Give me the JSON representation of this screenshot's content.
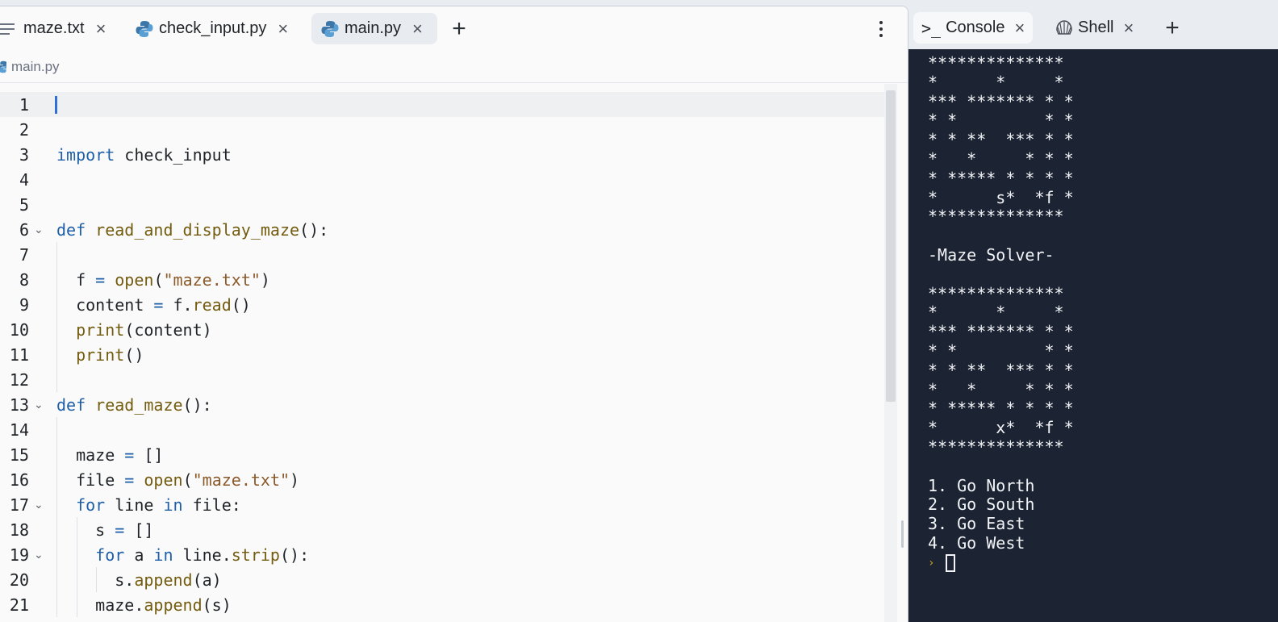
{
  "editor": {
    "tabs": [
      {
        "label": "maze.txt",
        "icon": "text-file-icon",
        "active": false
      },
      {
        "label": "check_input.py",
        "icon": "python-icon",
        "active": false
      },
      {
        "label": "main.py",
        "icon": "python-icon",
        "active": true
      }
    ],
    "tab_close_glyph": "×",
    "add_tab_glyph": "+",
    "breadcrumb": "main.py",
    "lines": [
      {
        "n": "1",
        "html": ""
      },
      {
        "n": "2",
        "html": ""
      },
      {
        "n": "3",
        "html": "<span class='kw'>import</span> check_input"
      },
      {
        "n": "4",
        "html": ""
      },
      {
        "n": "5",
        "html": ""
      },
      {
        "n": "6",
        "html": "<span class='kw'>def</span> <span class='fn'>read_and_display_maze</span>():",
        "fold": true
      },
      {
        "n": "7",
        "html": "",
        "indent": 1
      },
      {
        "n": "8",
        "html": "  f <span class='op'>=</span> <span class='fn'>open</span>(<span class='str'>\"maze.txt\"</span>)",
        "indent": 1
      },
      {
        "n": "9",
        "html": "  content <span class='op'>=</span> f.<span class='fn'>read</span>()",
        "indent": 1
      },
      {
        "n": "10",
        "html": "  <span class='fn'>print</span>(content)",
        "indent": 1
      },
      {
        "n": "11",
        "html": "  <span class='fn'>print</span>()",
        "indent": 1
      },
      {
        "n": "12",
        "html": "",
        "indent": 1
      },
      {
        "n": "13",
        "html": "<span class='kw'>def</span> <span class='fn'>read_maze</span>():",
        "fold": true
      },
      {
        "n": "14",
        "html": "",
        "indent": 1
      },
      {
        "n": "15",
        "html": "  maze <span class='op'>=</span> []",
        "indent": 1
      },
      {
        "n": "16",
        "html": "  file <span class='op'>=</span> <span class='fn'>open</span>(<span class='str'>\"maze.txt\"</span>)",
        "indent": 1
      },
      {
        "n": "17",
        "html": "  <span class='kw'>for</span> line <span class='kw'>in</span> file:",
        "fold": true,
        "indent": 1
      },
      {
        "n": "18",
        "html": "    s <span class='op'>=</span> []",
        "indent": 2
      },
      {
        "n": "19",
        "html": "    <span class='kw'>for</span> a <span class='kw'>in</span> line.<span class='fn'>strip</span>():",
        "fold": true,
        "indent": 2
      },
      {
        "n": "20",
        "html": "      s.<span class='fn'>append</span>(a)",
        "indent": 3
      },
      {
        "n": "21",
        "html": "    maze.<span class='fn'>append</span>(s)",
        "indent": 2
      }
    ]
  },
  "console": {
    "tabs": [
      {
        "label": "Console",
        "glyph": ">_",
        "active": true
      },
      {
        "label": "Shell",
        "glyph": "shell",
        "active": false
      }
    ],
    "tab_close_glyph": "×",
    "add_tab_glyph": "+",
    "output": "**************\n*      *     *\n*** ******* * *\n* *         * *\n* * **  *** * *\n*   *     * * *\n* ***** * * * *\n*      s*  *f *\n**************\n\n-Maze Solver-\n\n**************\n*      *     *\n*** ******* * *\n* *         * *\n* * **  *** * *\n*   *     * * *\n* ***** * * * *\n*      x*  *f *\n**************\n\n1. Go North\n2. Go South\n3. Go East\n4. Go West",
    "prompt_symbol": "›"
  },
  "colors": {
    "editor_bg": "#fafafa",
    "console_bg": "#1c2333",
    "keyword": "#1e5fa8",
    "function": "#735c0f",
    "string": "#8b5a2b",
    "cursor": "#2f6fd6"
  }
}
